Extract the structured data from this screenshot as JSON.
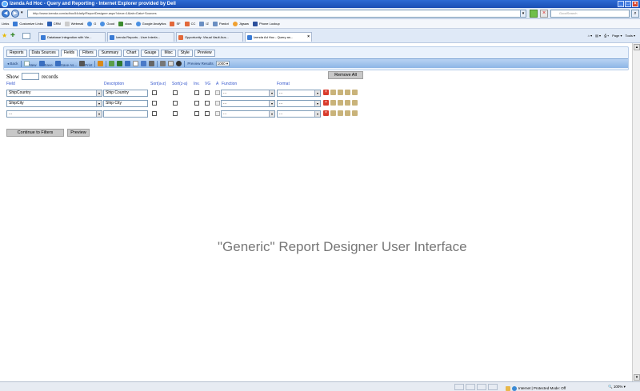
{
  "window": {
    "title": "Izenda Ad Hoc - Query and Reporting - Internet Explorer provided by Dell"
  },
  "browser": {
    "url": "http://www.izenda.com/adhoc54daily/ReportDesigner.aspx?clear=1&tab=Data+Sources",
    "search_placeholder": "GoodSearch",
    "links": [
      "Links",
      "Customize Links",
      "CRM",
      "Webmail",
      "G",
      "Good",
      "docs",
      "Google Analytics",
      "SF",
      "CC",
      "IZ",
      "Pardot",
      "Jigsaw",
      "Phone Lookup"
    ],
    "tabs": [
      {
        "label": "Database Integration with Vie..."
      },
      {
        "label": "Izenda Reports - User Interfa..."
      },
      {
        "label": "Opportunity: Visual Vault Aus..."
      },
      {
        "label": "Izenda Ad Hoc - Query an..."
      }
    ],
    "tools": [
      "Page",
      "Tools"
    ],
    "status_zone": "Internet | Protected Mode: Off",
    "zoom": "100%"
  },
  "designer": {
    "tabs": [
      "Reports",
      "Data Sources",
      "Fields",
      "Filters",
      "Summary",
      "Chart",
      "Gauge",
      "Misc",
      "Style",
      "Preview"
    ],
    "active_tab": "Fields",
    "toolbar": {
      "back": "Back",
      "new": "New",
      "save": "Save",
      "save_as": "Save As...",
      "print": "Print",
      "preview_results_label": "Preview Results",
      "preview_results_value": "1000"
    },
    "show_label": "Show",
    "records_label": "records",
    "remove_all": "Remove All",
    "columns": {
      "field": "Field",
      "description": "Description",
      "sort_az": "Sort(a-z)",
      "sort_za": "Sort(z-a)",
      "inv": "Inv.",
      "vg": "VG",
      "a": "A",
      "function": "Function",
      "format": "Format"
    },
    "rows": [
      {
        "field": "ShipCountry",
        "description": "Ship Country",
        "function": "...",
        "format": "..."
      },
      {
        "field": "ShipCity",
        "description": "Ship City",
        "function": "...",
        "format": "..."
      },
      {
        "field": "...",
        "description": "",
        "function": "...",
        "format": "..."
      }
    ],
    "continue_button": "Continue to Filters",
    "preview_button": "Preview"
  },
  "caption": "\"Generic\" Report Designer User Interface"
}
